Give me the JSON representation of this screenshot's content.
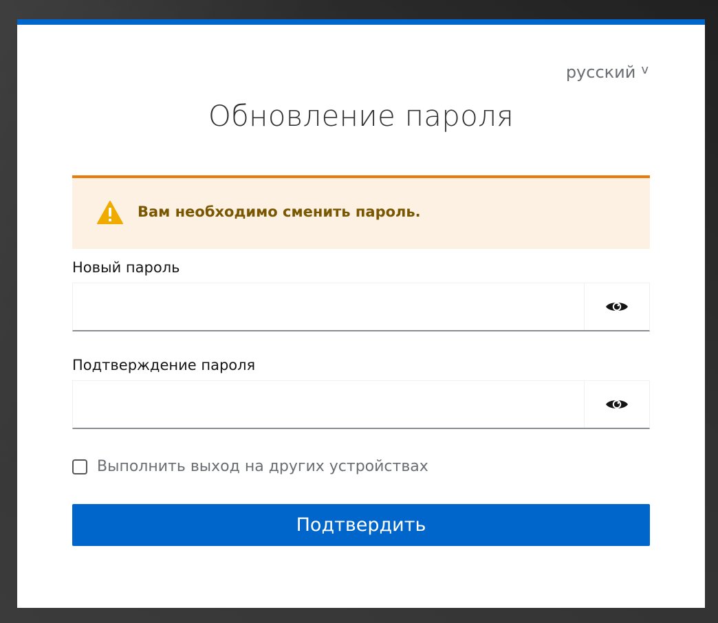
{
  "language_selector": {
    "label": "русский",
    "chevron": "v",
    "icon": "chevron-down-icon"
  },
  "page": {
    "title": "Обновление пароля"
  },
  "alert": {
    "icon": "warning-icon",
    "message": "Вам необходимо сменить пароль.",
    "colors": {
      "background": "#fdf1e4",
      "border": "#ec7a08",
      "text": "#795600",
      "icon": "#f0ab00"
    }
  },
  "form": {
    "new_password": {
      "label": "Новый пароль",
      "value": "",
      "toggle_icon": "eye-icon"
    },
    "confirm_password": {
      "label": "Подтверждение пароля",
      "value": "",
      "toggle_icon": "eye-icon"
    },
    "logout_other_devices": {
      "label": "Выполнить выход на других устройствах",
      "checked": false
    },
    "submit_label": "Подтвердить"
  },
  "colors": {
    "accent": "#0066cc",
    "background": "#333333",
    "card": "#ffffff"
  }
}
